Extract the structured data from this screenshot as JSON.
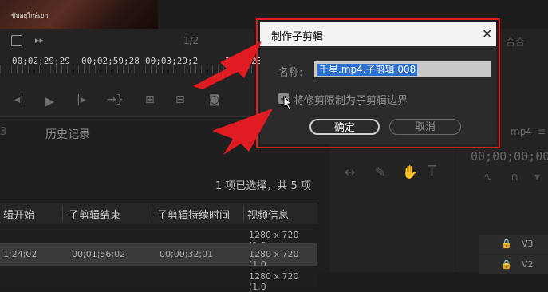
{
  "source": {
    "thumb_text": "ขับลยุไกล์เยก",
    "timecodes": [
      "00;02;29;29",
      "00;02;59;28",
      "00;03;29;2",
      "3;59;28"
    ],
    "page_num": "1/2",
    "right_tab": "合合"
  },
  "panel": {
    "tab_number": "3",
    "history_tab": "历史记录",
    "selection_info": "1 项已选择，共 5 项",
    "columns": [
      "辑开始",
      "子剪辑结束",
      "子剪辑持续时间",
      "视频信息"
    ],
    "rows": [
      [
        "",
        "",
        "",
        "1280 x 720 (1.0"
      ],
      [
        "1;24;02",
        "00;01;56;02",
        "00;00;32;01",
        "1280 x 720 (1.0"
      ],
      [
        "",
        "",
        "",
        "1280 x 720 (1.0"
      ]
    ]
  },
  "program": {
    "tab": "mp4",
    "timecode": "00;00;00;00",
    "tracks": [
      "V3",
      "V2"
    ]
  },
  "dialog": {
    "title": "制作子剪辑",
    "name_label": "名称:",
    "name_value": "千星.mp4.子剪辑 008",
    "checkbox_label": "将修剪限制为子剪辑边界",
    "checkbox_checked": true,
    "ok_label": "确定",
    "cancel_label": "取消"
  },
  "colors": {
    "highlight_border": "#e11b22",
    "selection_blue": "#2b6fd1"
  }
}
